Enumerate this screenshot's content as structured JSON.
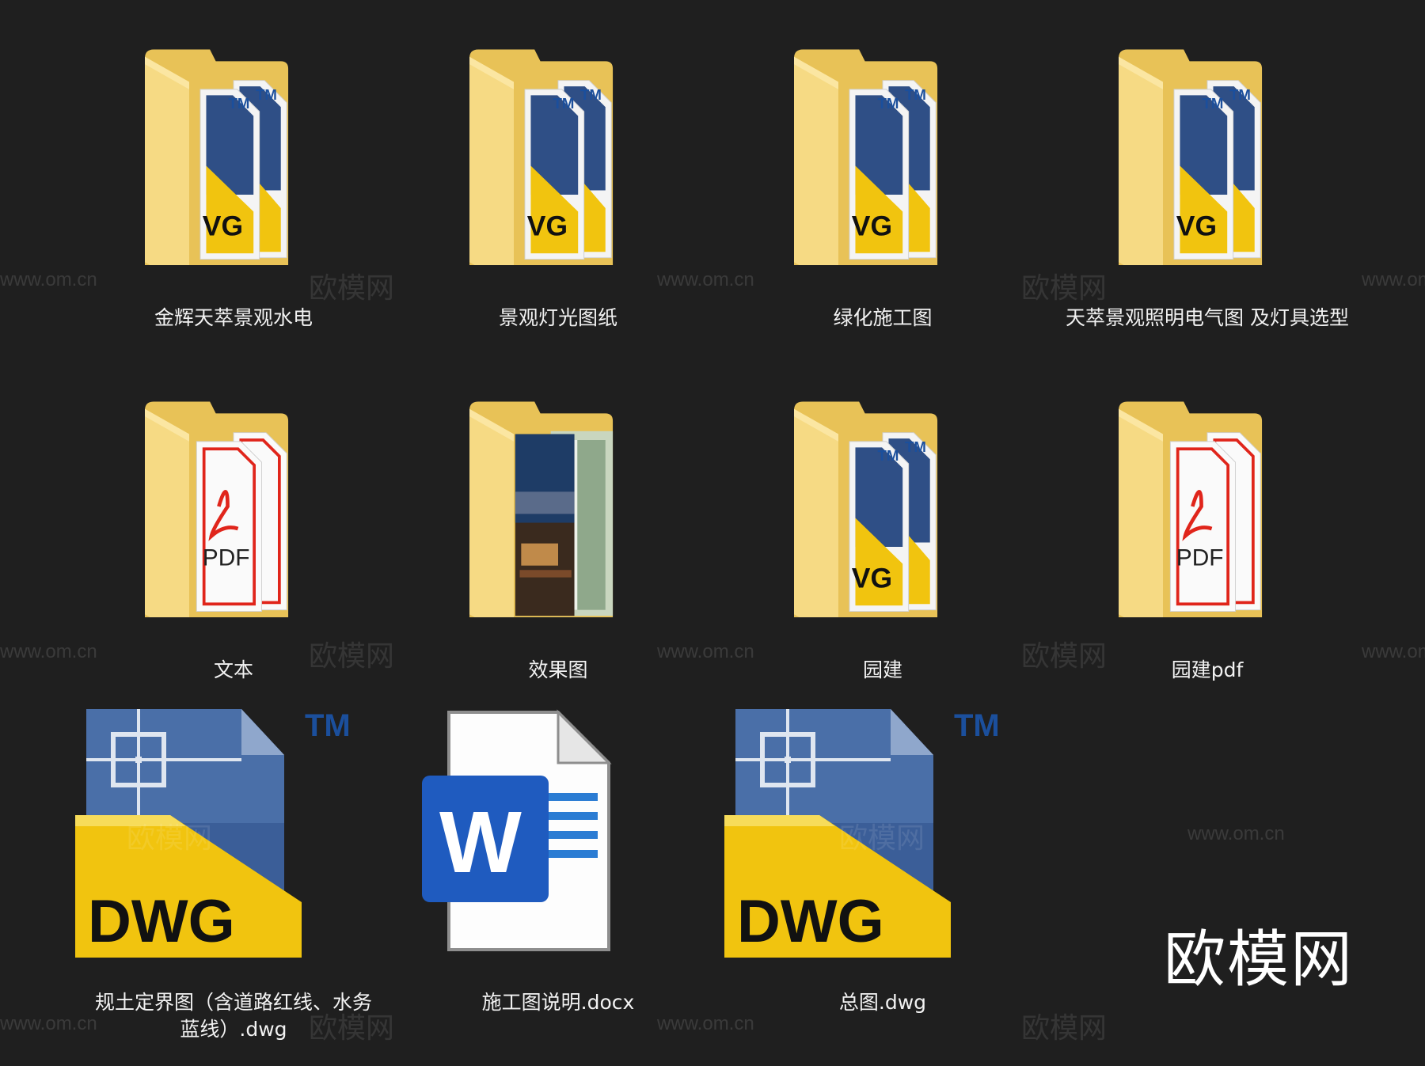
{
  "items": [
    {
      "label": "金辉天萃景观水电",
      "kind": "folder-dwg"
    },
    {
      "label": "景观灯光图纸",
      "kind": "folder-dwg"
    },
    {
      "label": "绿化施工图",
      "kind": "folder-dwg"
    },
    {
      "label": "天萃景观照明电气图 及灯具选型",
      "kind": "folder-dwg"
    },
    {
      "label": "文本",
      "kind": "folder-pdf"
    },
    {
      "label": "效果图",
      "kind": "folder-image"
    },
    {
      "label": "园建",
      "kind": "folder-dwg"
    },
    {
      "label": "园建pdf",
      "kind": "folder-pdf"
    },
    {
      "label": "规土定界图（含道路红线、水务蓝线）.dwg",
      "kind": "file-dwg"
    },
    {
      "label": "施工图说明.docx",
      "kind": "file-docx"
    },
    {
      "label": "总图.dwg",
      "kind": "file-dwg"
    }
  ],
  "icon_text": {
    "dwg": "DWG",
    "tm": "TM",
    "pdf": "PDF",
    "word": "W"
  },
  "watermark": {
    "url": "www.om.cn",
    "cn": "欧模网"
  },
  "brand": "欧模网",
  "colors": {
    "background": "#1f1f1f",
    "folder": "#f3d57a",
    "dwg_yellow": "#f1c40f",
    "dwg_blue": "#2f4f86",
    "word_blue": "#1f5bbf",
    "pdf_red": "#e0251b"
  }
}
